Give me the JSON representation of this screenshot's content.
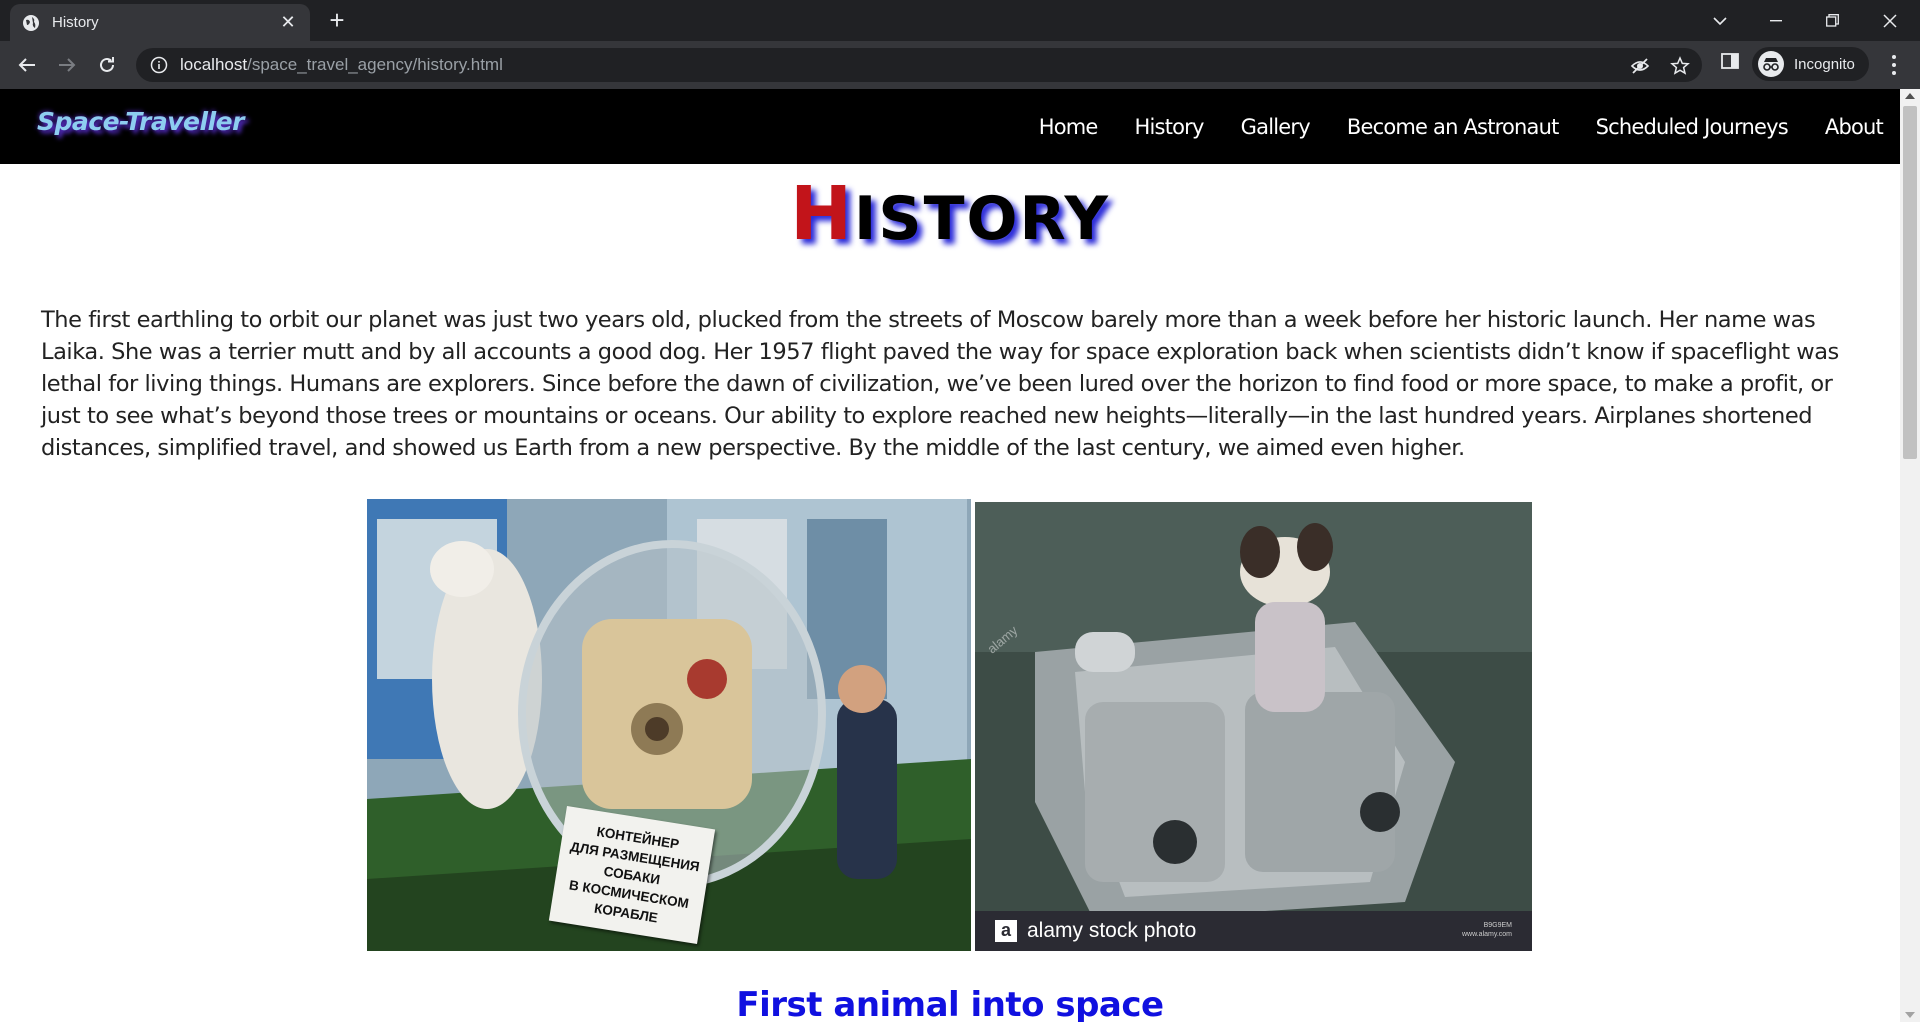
{
  "browser": {
    "tab_title": "History",
    "url_host": "localhost",
    "url_path": "/space_travel_agency/history.html",
    "profile_label": "Incognito"
  },
  "site": {
    "brand": "Space-Traveller",
    "nav": [
      "Home",
      "History",
      "Gallery",
      "Become an Astronaut",
      "Scheduled Journeys",
      "About"
    ],
    "title_first": "H",
    "title_rest": "ISTORY",
    "intro": "The first earthling to orbit our planet was just two years old, plucked from the streets of Moscow barely more than a week before her historic launch. Her name was Laika. She was a terrier mutt and by all accounts a good dog. Her 1957 flight paved the way for space exploration back when scientists didn’t know if spaceflight was lethal for living things. Humans are explorers. Since before the dawn of civilization, we’ve been lured over the horizon to find food or more space, to make a profit, or just to see what’s beyond those trees or mountains or oceans. Our ability to explore reached new heights—literally—in the last hundred years. Airplanes shortened distances, simplified travel, and showed us Earth from a new perspective. By the middle of the last century, we aimed even higher.",
    "photo1_sign": [
      "КОНТЕЙНЕР",
      "ДЛЯ РАЗМЕЩЕНИЯ",
      "СОБАКИ",
      "В КОСМИЧЕСКОМ",
      "КОРАБЛЕ"
    ],
    "photo2_watermark": "alamy stock photo",
    "photo2_code": [
      "B9G9EM",
      "www.alamy.com"
    ],
    "section_heading": "First animal into space"
  },
  "colors": {
    "brand_text": "#8ecdf0",
    "title_accent": "#c2141a",
    "section_heading": "#1010e0",
    "nav_bg": "#000000"
  }
}
